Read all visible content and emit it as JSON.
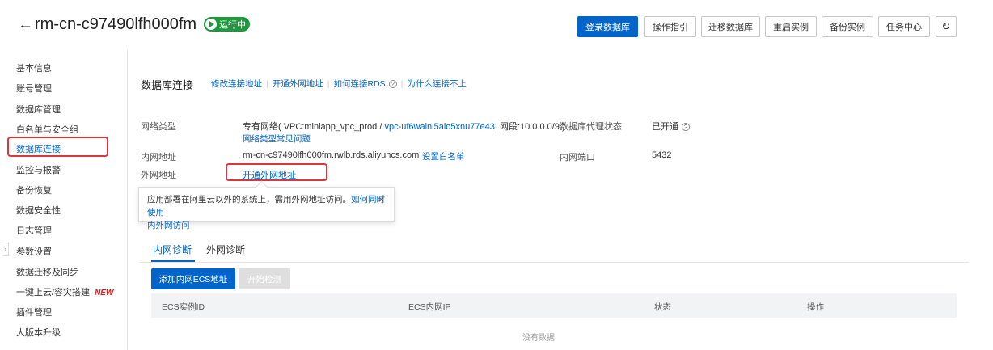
{
  "header": {
    "back_icon": "←",
    "instance_id": "rm-cn-c97490lfh000fm",
    "status": "运行中",
    "buttons": {
      "login_db": "登录数据库",
      "guide": "操作指引",
      "migrate": "迁移数据库",
      "restart": "重启实例",
      "backup": "备份实例",
      "tasks": "任务中心",
      "refresh_icon": "↻"
    }
  },
  "sidebar": {
    "items": [
      "基本信息",
      "账号管理",
      "数据库管理",
      "白名单与安全组",
      "数据库连接",
      "监控与报警",
      "备份恢复",
      "数据安全性",
      "日志管理",
      "参数设置",
      "数据迁移及同步",
      "一键上云/容灾搭建",
      "插件管理",
      "大版本升级"
    ],
    "new_badge": "NEW",
    "collapse_icon": "›"
  },
  "section": {
    "title": "数据库连接",
    "links": {
      "modify_address": "修改连接地址",
      "open_public": "开通外网地址",
      "how_connect": "如何连接RDS",
      "why_fail": "为什么连接不上"
    },
    "help_icon": "?"
  },
  "details": {
    "network_type_label": "网络类型",
    "network_type_prefix": "专有网络( VPC:miniapp_vpc_prod / ",
    "vpc_link": "vpc-uf6walnl5aio5xnu77e43",
    "network_type_suffix": ", 网段:10.0.0.0/9 )",
    "network_faq": "网络类型常见问题",
    "proxy_label": "数据库代理状态",
    "proxy_value": "已开通",
    "internal_label": "内网地址",
    "internal_value": "rm-cn-c97490lfh000fm.rwlb.rds.aliyuncs.com",
    "set_whitelist": "设置白名单",
    "port_label": "内网端口",
    "port_value": "5432",
    "external_label": "外网地址",
    "external_link": "开通外网地址"
  },
  "popover": {
    "text": "应用部署在阿里云以外的系统上，需用外网地址访问。",
    "link_part1": "如何同时使用",
    "link_part2": "内外网访问",
    "close_icon": "×"
  },
  "tabs": [
    "内网诊断",
    "外网诊断"
  ],
  "actions": {
    "add_ecs": "添加内网ECS地址",
    "start_check": "开始检测"
  },
  "table": {
    "columns": [
      "ECS实例ID",
      "ECS内网IP",
      "状态",
      "操作"
    ],
    "empty_text": "没有数据"
  },
  "colors": {
    "accent": "#0064c8",
    "running": "#1d9a3b",
    "highlight": "#d9363e",
    "new_badge": "#e02020"
  }
}
